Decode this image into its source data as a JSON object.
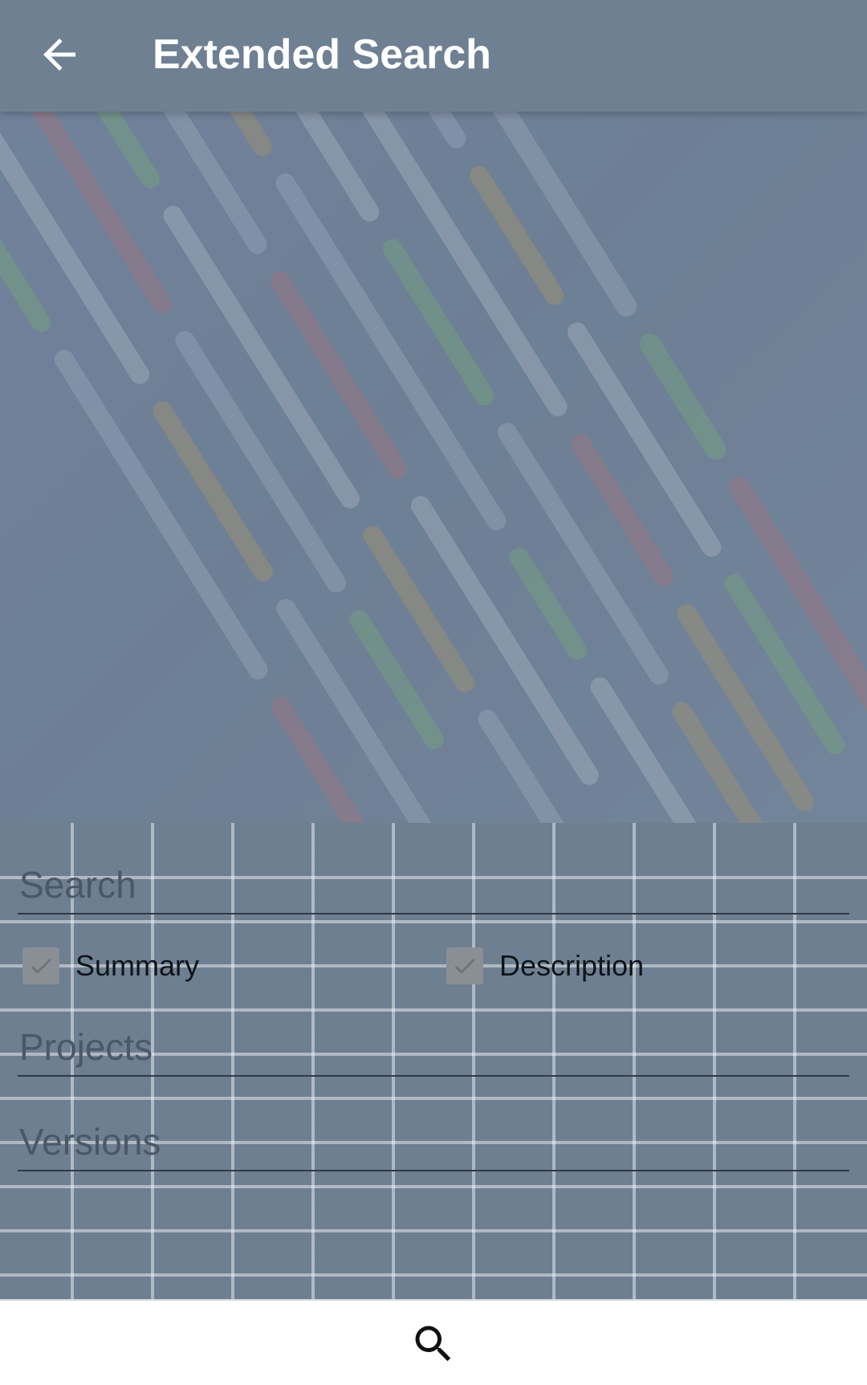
{
  "app_bar": {
    "title": "Extended Search",
    "back_icon": "arrow-left-icon",
    "background": "#6f8093"
  },
  "form": {
    "search_placeholder": "Search",
    "summary_label": "Summary",
    "summary_checked": true,
    "description_label": "Description",
    "description_checked": true,
    "projects_placeholder": "Projects",
    "versions_placeholder": "Versions"
  },
  "bottom_bar": {
    "search_icon": "search-icon"
  },
  "colors": {
    "overlay": "#6e7f92",
    "text_dark": "#0f1419",
    "white": "#ffffff"
  }
}
